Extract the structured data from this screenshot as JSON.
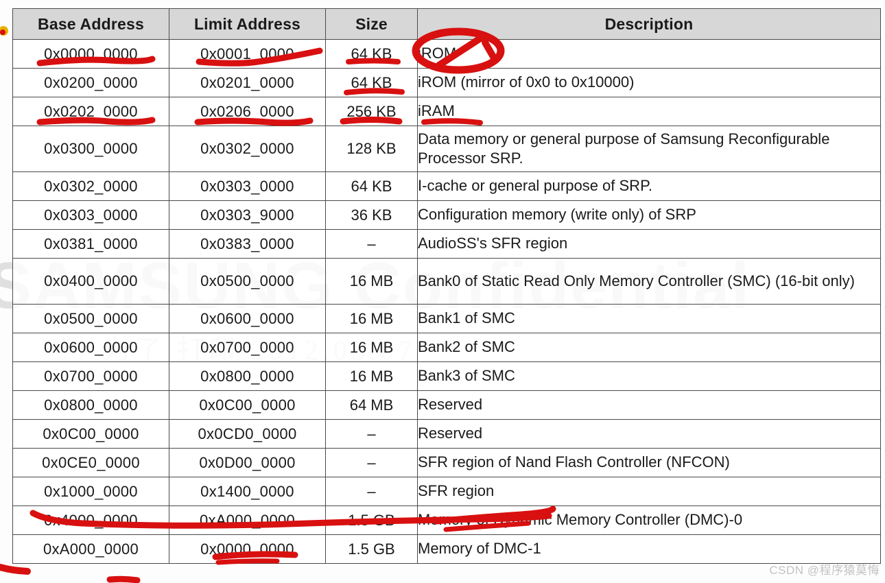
{
  "document": {
    "kind": "scanned-datasheet-table",
    "watermark_main": "SAMSUNG Confidential",
    "watermark_sub": "为了 打印 2012.05.07",
    "site_watermark": "CSDN @程序猿莫悔"
  },
  "table": {
    "name": "memory-map-table",
    "headers": [
      "Base Address",
      "Limit Address",
      "Size",
      "Description"
    ],
    "rows": [
      {
        "base": "0x0000_0000",
        "limit": "0x0001_0000",
        "size": "64 KB",
        "description": "iROM",
        "annotated": true
      },
      {
        "base": "0x0200_0000",
        "limit": "0x0201_0000",
        "size": "64 KB",
        "description": "iROM (mirror of 0x0 to 0x10000)",
        "annotated": true
      },
      {
        "base": "0x0202_0000",
        "limit": "0x0206_0000",
        "size": "256 KB",
        "description": "iRAM",
        "annotated": true
      },
      {
        "base": "0x0300_0000",
        "limit": "0x0302_0000",
        "size": "128 KB",
        "description": "Data memory or general purpose of Samsung Reconfigurable Processor SRP.",
        "annotated": false
      },
      {
        "base": "0x0302_0000",
        "limit": "0x0303_0000",
        "size": "64 KB",
        "description": "I-cache or general purpose of SRP.",
        "annotated": false
      },
      {
        "base": "0x0303_0000",
        "limit": "0x0303_9000",
        "size": "36 KB",
        "description": "Configuration memory (write only) of SRP",
        "annotated": false
      },
      {
        "base": "0x0381_0000",
        "limit": "0x0383_0000",
        "size": "–",
        "description": "AudioSS's SFR region",
        "annotated": false
      },
      {
        "base": "0x0400_0000",
        "limit": "0x0500_0000",
        "size": "16 MB",
        "description": "Bank0 of Static Read Only Memory Controller (SMC) (16-bit only)",
        "annotated": false
      },
      {
        "base": "0x0500_0000",
        "limit": "0x0600_0000",
        "size": "16 MB",
        "description": "Bank1 of SMC",
        "annotated": false
      },
      {
        "base": "0x0600_0000",
        "limit": "0x0700_0000",
        "size": "16 MB",
        "description": "Bank2 of SMC",
        "annotated": false
      },
      {
        "base": "0x0700_0000",
        "limit": "0x0800_0000",
        "size": "16 MB",
        "description": "Bank3 of SMC",
        "annotated": false
      },
      {
        "base": "0x0800_0000",
        "limit": "0x0C00_0000",
        "size": "64 MB",
        "description": "Reserved",
        "annotated": false
      },
      {
        "base": "0x0C00_0000",
        "limit": "0x0CD0_0000",
        "size": "–",
        "description": "Reserved",
        "annotated": false
      },
      {
        "base": "0x0CE0_0000",
        "limit": "0x0D00_0000",
        "size": "–",
        "description": "SFR region of Nand Flash Controller (NFCON)",
        "annotated": false
      },
      {
        "base": "0x1000_0000",
        "limit": "0x1400_0000",
        "size": "–",
        "description": "SFR region",
        "annotated": true
      },
      {
        "base": "0x4000_0000",
        "limit": "0xA000_0000",
        "size": "1.5 GB",
        "description": "Memory of Dynamic Memory Controller (DMC)-0",
        "annotated": true
      },
      {
        "base": "0xA000_0000",
        "limit": "0x0000_0000",
        "size": "1.5 GB",
        "description": "Memory of DMC-1",
        "annotated": true
      }
    ]
  },
  "annotations": {
    "ink_color": "#d81010",
    "marks": [
      {
        "type": "circle",
        "target": "iROM",
        "row": 0,
        "column": "Description"
      },
      {
        "type": "underline",
        "target": "0x0000_0000",
        "row": 0,
        "column": "Base Address"
      },
      {
        "type": "underline",
        "target": "0x0001_0000",
        "row": 0,
        "column": "Limit Address"
      },
      {
        "type": "underline",
        "target": "64 KB",
        "row": 0,
        "column": "Size"
      },
      {
        "type": "underline",
        "target": "64 KB",
        "row": 1,
        "column": "Size"
      },
      {
        "type": "underline",
        "target": "0x0202_0000",
        "row": 2,
        "column": "Base Address"
      },
      {
        "type": "underline",
        "target": "0x0206_0000",
        "row": 2,
        "column": "Limit Address"
      },
      {
        "type": "underline",
        "target": "256 KB",
        "row": 2,
        "column": "Size"
      },
      {
        "type": "underline",
        "target": "iRAM",
        "row": 2,
        "column": "Description"
      },
      {
        "type": "underline",
        "target": "SFR region row",
        "row": 14,
        "column": "full-width"
      },
      {
        "type": "underline",
        "target": "Memory of DMC-0",
        "row": 15,
        "column": "Description"
      },
      {
        "type": "strikethrough",
        "target": "0x0000_0000",
        "row": 16,
        "column": "Limit Address"
      },
      {
        "type": "stroke",
        "target": "page-bottom-left",
        "row": null,
        "column": null
      },
      {
        "type": "dot",
        "target": "page-left-margin",
        "row": null,
        "column": null
      }
    ]
  }
}
